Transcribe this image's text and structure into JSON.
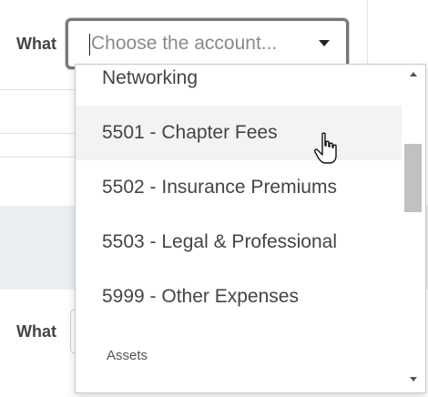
{
  "form": {
    "row1": {
      "label": "What",
      "select_placeholder": "Choose the account..."
    },
    "row2": {
      "label": "What"
    }
  },
  "dropdown": {
    "items": [
      {
        "label": "Networking",
        "state": "default"
      },
      {
        "label": "5501 - Chapter Fees",
        "state": "hover"
      },
      {
        "label": "5502 - Insurance Premiums",
        "state": "default"
      },
      {
        "label": "5503 - Legal & Professional",
        "state": "default"
      },
      {
        "label": "5999 - Other Expenses",
        "state": "default"
      }
    ],
    "group_header": "Assets"
  },
  "icons": {
    "select_arrow": "caret-down-icon",
    "scroll_up": "scroll-up-arrow-icon",
    "scroll_down": "scroll-down-arrow-icon",
    "cursor": "hand-pointer-cursor-icon"
  },
  "colors": {
    "hover_bg": "#f1f3f4",
    "band_bg": "#eceff1",
    "select_border": "#777777"
  }
}
